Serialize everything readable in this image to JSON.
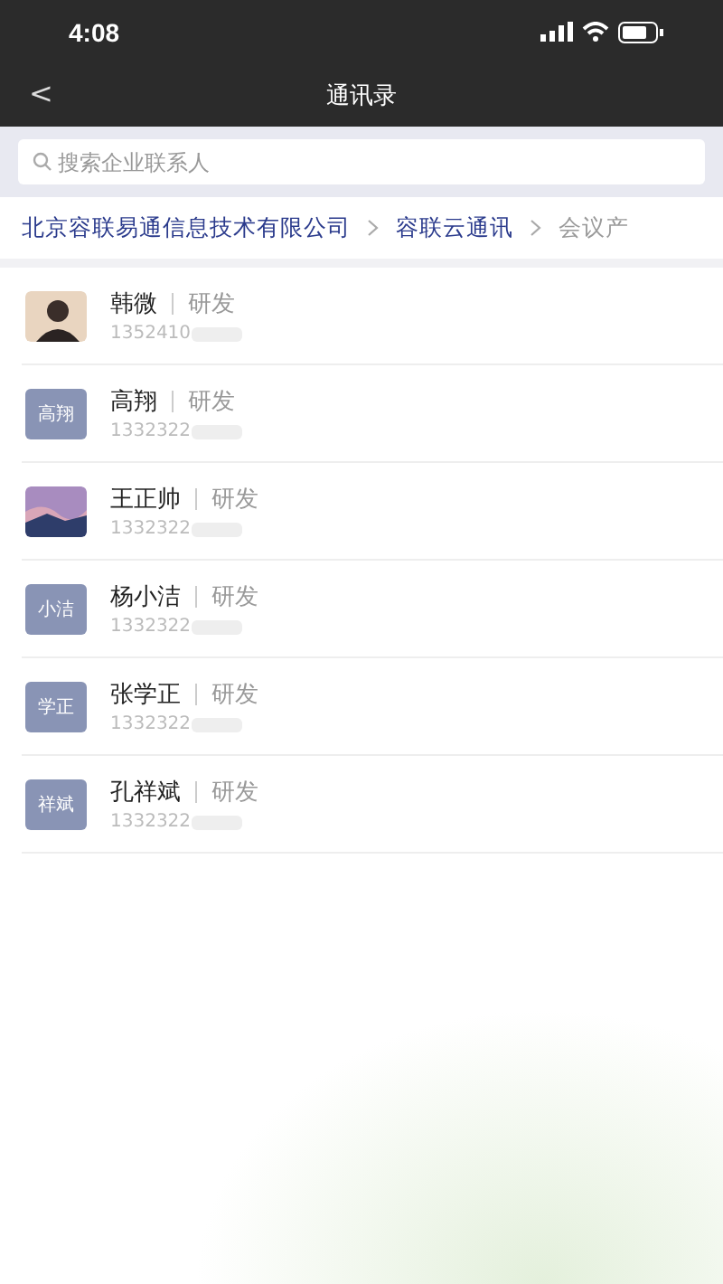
{
  "status_bar": {
    "time": "4:08"
  },
  "nav": {
    "back": "<",
    "title": "通讯录"
  },
  "search": {
    "placeholder": "搜索企业联系人"
  },
  "breadcrumb": [
    {
      "label": "北京容联易通信息技术有限公司",
      "selected": false
    },
    {
      "label": "容联云通讯",
      "selected": false
    },
    {
      "label": "会议产",
      "selected": true
    }
  ],
  "contacts": [
    {
      "name": "韩微",
      "dept": "研发",
      "phone": "1352410",
      "avatar": {
        "kind": "photo"
      }
    },
    {
      "name": "高翔",
      "dept": "研发",
      "phone": "1332322",
      "avatar": {
        "kind": "initials",
        "text": "高翔"
      }
    },
    {
      "name": "王正帅",
      "dept": "研发",
      "phone": "1332322",
      "avatar": {
        "kind": "scenery"
      }
    },
    {
      "name": "杨小洁",
      "dept": "研发",
      "phone": "1332322",
      "avatar": {
        "kind": "initials",
        "text": "小洁"
      }
    },
    {
      "name": "张学正",
      "dept": "研发",
      "phone": "1332322",
      "avatar": {
        "kind": "initials",
        "text": "学正"
      }
    },
    {
      "name": "孔祥斌",
      "dept": "研发",
      "phone": "1332322",
      "avatar": {
        "kind": "initials",
        "text": "祥斌"
      }
    }
  ]
}
